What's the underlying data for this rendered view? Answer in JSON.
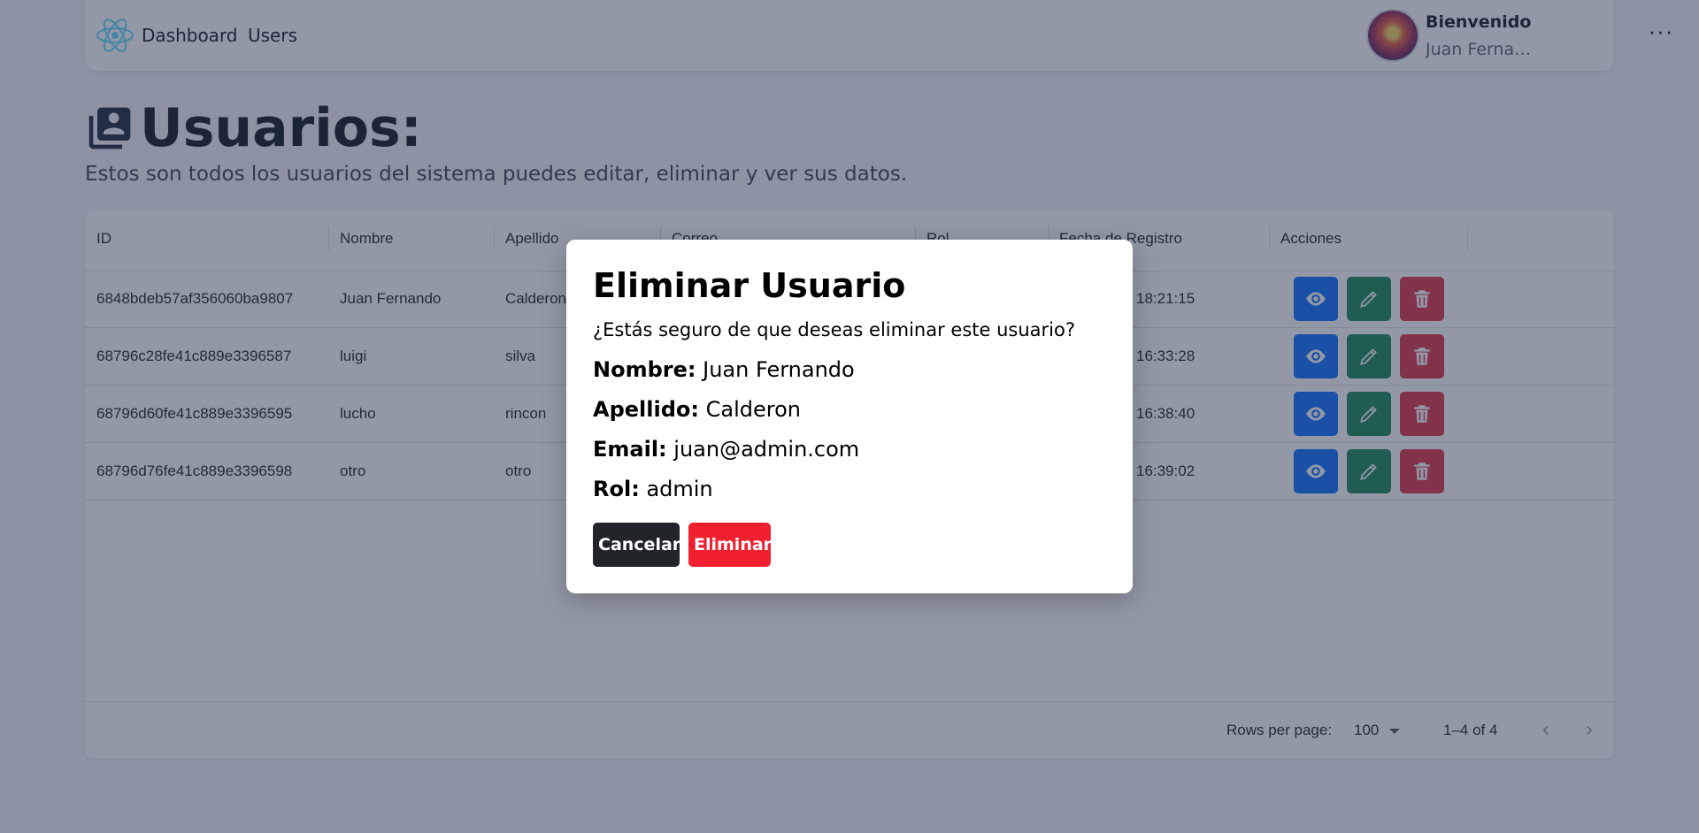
{
  "navbar": {
    "links": {
      "dashboard": "Dashboard",
      "users": "Users"
    },
    "welcome": "Bienvenido",
    "username": "Juan Fernando",
    "more_label": "···"
  },
  "page": {
    "title": "Usuarios:",
    "subtitle": "Estos son todos los usuarios del sistema puedes editar, eliminar y ver sus datos."
  },
  "table": {
    "columns": [
      "ID",
      "Nombre",
      "Apellido",
      "Correo",
      "Rol",
      "Fecha de Registro",
      "Acciones"
    ],
    "rows": [
      {
        "id": "6848bdeb57af356060ba9807",
        "nombre": "Juan Fernando",
        "apellido": "Calderon",
        "fecha": "18:21:15"
      },
      {
        "id": "68796c28fe41c889e3396587",
        "nombre": "luigi",
        "apellido": "silva",
        "fecha": "16:33:28"
      },
      {
        "id": "68796d60fe41c889e3396595",
        "nombre": "lucho",
        "apellido": "rincon",
        "fecha": "16:38:40"
      },
      {
        "id": "68796d76fe41c889e3396598",
        "nombre": "otro",
        "apellido": "otro",
        "fecha": "16:39:02"
      }
    ],
    "footer": {
      "rows_per_page_label": "Rows per page:",
      "rows_per_page_value": "100",
      "range": "1–4 of 4",
      "prev": "‹",
      "next": "›"
    }
  },
  "modal": {
    "title": "Eliminar Usuario",
    "question": "¿Estás seguro de que deseas eliminar este usuario?",
    "fields": [
      {
        "label": "Nombre:",
        "value": "Juan Fernando"
      },
      {
        "label": "Apellido:",
        "value": "Calderon"
      },
      {
        "label": "Email:",
        "value": "juan@admin.com"
      },
      {
        "label": "Rol:",
        "value": "admin"
      }
    ],
    "cancel_label": "Cancelar",
    "delete_label": "Eliminar"
  },
  "colors": {
    "view": "#0d6efd",
    "edit": "#198754",
    "delete": "#dc3545",
    "modal_delete": "#f1202f",
    "modal_cancel": "#212529"
  }
}
